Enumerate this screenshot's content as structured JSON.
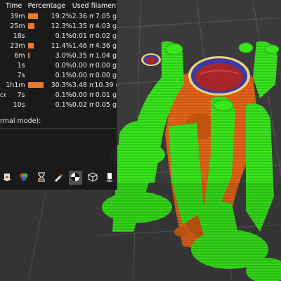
{
  "statistics": {
    "headers": {
      "time": "Time",
      "percentage": "Percentage",
      "used_filament": "Used filament"
    },
    "rows": [
      {
        "feature": "",
        "time": "39m",
        "percentage": "19.2%",
        "fraction": 0.192,
        "length": "2.36 m",
        "weight": "7.05 g"
      },
      {
        "feature": "",
        "time": "25m",
        "percentage": "12.3%",
        "fraction": 0.123,
        "length": "1.35 m",
        "weight": "4.03 g"
      },
      {
        "feature": "",
        "time": "18s",
        "percentage": "0.1%",
        "fraction": 0.001,
        "length": "0.01 m",
        "weight": "0.02 g"
      },
      {
        "feature": "",
        "time": "23m",
        "percentage": "11.4%",
        "fraction": 0.114,
        "length": "1.46 m",
        "weight": "4.36 g"
      },
      {
        "feature": "",
        "time": "6m",
        "percentage": "3.0%",
        "fraction": 0.03,
        "length": "0.35 m",
        "weight": "1.04 g"
      },
      {
        "feature": "",
        "time": "1s",
        "percentage": "0.0%",
        "fraction": 0.0,
        "length": "0.00 m",
        "weight": "0.00 g"
      },
      {
        "feature": "",
        "time": "7s",
        "percentage": "0.1%",
        "fraction": 0.001,
        "length": "0.00 m",
        "weight": "0.00 g"
      },
      {
        "feature": "",
        "time": "1h1m",
        "percentage": "30.3%",
        "fraction": 0.303,
        "length": "3.48 m",
        "weight": "10.39 g"
      },
      {
        "feature": "ce",
        "time": "7s",
        "percentage": "0.1%",
        "fraction": 0.001,
        "length": "0.00 m",
        "weight": "0.01 g"
      },
      {
        "feature": "",
        "time": "10s",
        "percentage": "0.1%",
        "fraction": 0.001,
        "length": "0.02 m",
        "weight": "0.05 g"
      }
    ]
  },
  "legend_label": "rmal mode):",
  "toolbar": {
    "buttons": [
      {
        "name": "view-travel-icon",
        "active": false
      },
      {
        "name": "view-color-wipe-icon",
        "active": false
      },
      {
        "name": "view-timelapse-icon",
        "active": false
      },
      {
        "name": "view-seam-icon",
        "active": false
      },
      {
        "name": "view-shells-icon",
        "active": true
      },
      {
        "name": "view-cube-icon",
        "active": false
      },
      {
        "name": "view-toolmarker-icon",
        "active": false
      }
    ]
  },
  "colors": {
    "support": "#39e61c",
    "support_dark": "#1f9e10",
    "model": "#e06418",
    "model_dark": "#a8440c",
    "top_fill": "#a6262a",
    "panel_bg": "#181818",
    "bar": "#ea7b2b",
    "bed": "#3a3a3a"
  }
}
